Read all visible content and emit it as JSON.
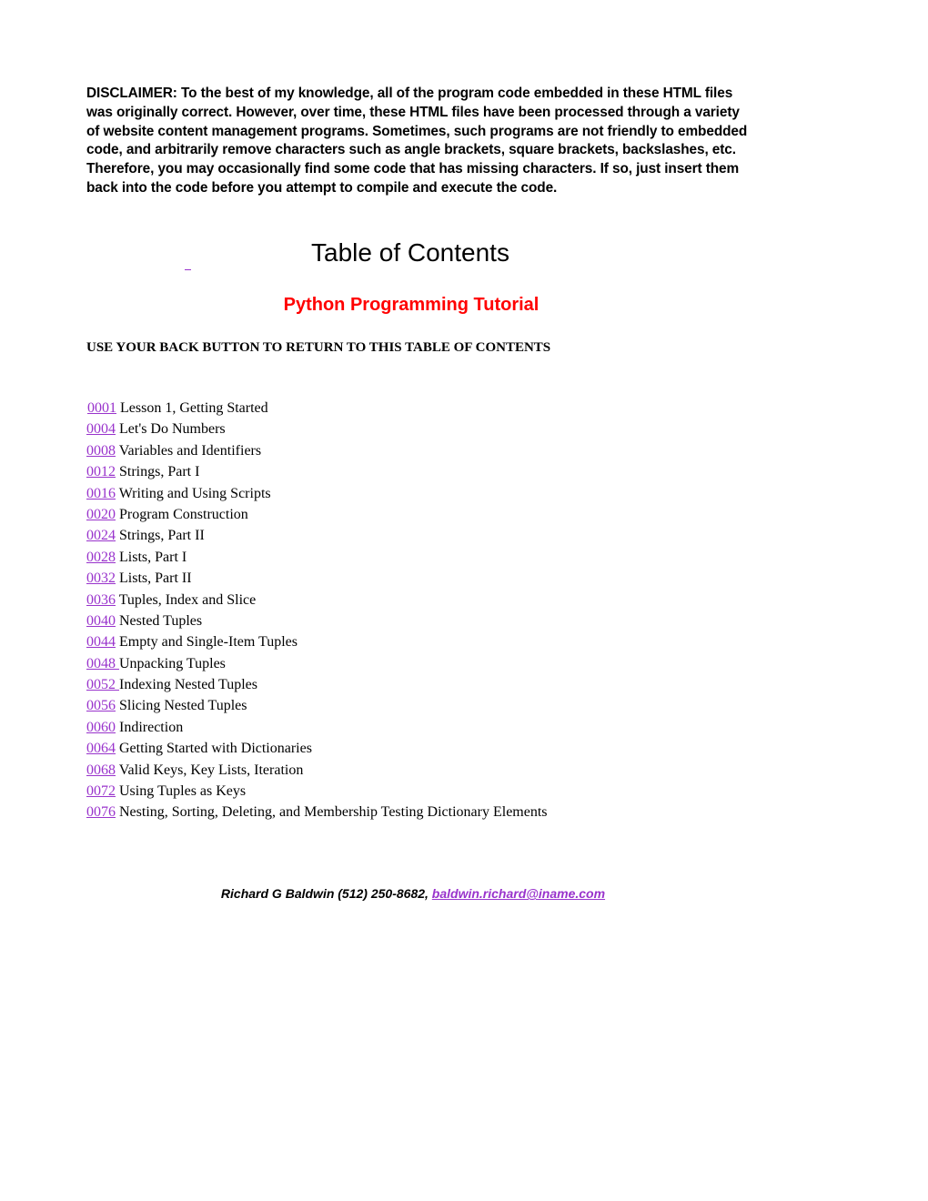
{
  "disclaimer": "DISCLAIMER: To the best of my knowledge, all of the program code embedded in these HTML files was originally correct. However, over time, these HTML files have been processed through a variety of website content management programs. Sometimes, such programs are not friendly to embedded code, and arbitrarily remove characters such as angle brackets, square brackets, backslashes, etc. Therefore, you may occasionally find some code that has missing characters. If so, just insert them back into the code before you attempt to compile and execute the code.",
  "title": "Table of Contents",
  "subtitle": "Python Programming Tutorial",
  "back_note": "USE YOUR BACK BUTTON TO RETURN TO THIS TABLE OF CONTENTS",
  "colors": {
    "link": "#9933cc",
    "subtitle": "#ff0000"
  },
  "toc": [
    {
      "number": "0001",
      "title": "Lesson 1, Getting Started"
    },
    {
      "number": "0004",
      "title": "Let's Do Numbers"
    },
    {
      "number": "0008",
      "title": "Variables and Identifiers"
    },
    {
      "number": "0012",
      "title": "Strings, Part I"
    },
    {
      "number": "0016",
      "title": "Writing and Using Scripts"
    },
    {
      "number": "0020",
      "title": "Program Construction"
    },
    {
      "number": "0024",
      "title": "Strings, Part II"
    },
    {
      "number": "0028",
      "title": "Lists, Part I"
    },
    {
      "number": "0032",
      "title": "Lists, Part II"
    },
    {
      "number": "0036",
      "title": "Tuples, Index and Slice"
    },
    {
      "number": "0040",
      "title": "Nested Tuples"
    },
    {
      "number": "0044",
      "title": "Empty and Single-Item Tuples"
    },
    {
      "number": "0048 ",
      "title": "Unpacking Tuples"
    },
    {
      "number": "0052 ",
      "title": "Indexing Nested Tuples"
    },
    {
      "number": "0056",
      "title": "Slicing Nested Tuples"
    },
    {
      "number": "0060",
      "title": "Indirection"
    },
    {
      "number": "0064",
      "title": "Getting Started with Dictionaries"
    },
    {
      "number": "0068",
      "title": "Valid Keys, Key Lists, Iteration"
    },
    {
      "number": "0072",
      "title": "Using Tuples as Keys"
    },
    {
      "number": "0076",
      "title": "Nesting, Sorting, Deleting, and Membership Testing Dictionary Elements"
    }
  ],
  "author": {
    "text": "Richard G Baldwin (512) 250-8682, ",
    "email": "baldwin.richard@iname.com"
  }
}
